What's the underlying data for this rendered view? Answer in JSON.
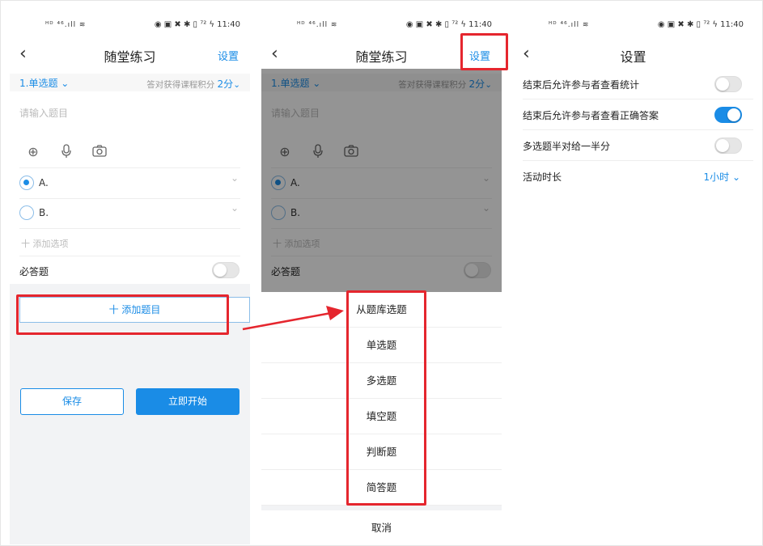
{
  "status": {
    "left": "ᴴᴰ ⁴⁶.ıll ≋",
    "right": "◉ ▣ ✖ ✱ ▯ ⁷² ϟ 11:40"
  },
  "editor": {
    "title": "随堂练习",
    "settings_label": "设置",
    "question_type": "1.单选题",
    "score_prefix": "答对获得课程积分",
    "score_value": "2分",
    "prompt_placeholder": "请输入题目",
    "options": [
      {
        "label": "A.",
        "selected": true
      },
      {
        "label": "B.",
        "selected": false
      }
    ],
    "add_option": "十 添加选项",
    "required_label": "必答题",
    "required_on": false,
    "add_question": "十 添加题目",
    "save_label": "保存",
    "start_label": "立即开始"
  },
  "action_sheet": {
    "items": [
      "从题库选题",
      "单选题",
      "多选题",
      "填空题",
      "判断题",
      "简答题"
    ],
    "cancel": "取消"
  },
  "settings": {
    "title": "设置",
    "rows": [
      {
        "label": "结束后允许参与者查看统计",
        "on": false
      },
      {
        "label": "结束后允许参与者查看正确答案",
        "on": true
      },
      {
        "label": "多选题半对给一半分",
        "on": false
      }
    ],
    "duration_label": "活动时长",
    "duration_value": "1小时"
  },
  "icons": {
    "back": "chevron-left-icon",
    "add": "plus-circle-icon",
    "mic": "microphone-icon",
    "camera": "camera-icon",
    "chevron": "chevron-down-icon"
  },
  "colors": {
    "accent": "#1a8ce6",
    "highlight": "#e5262e",
    "overlay": "rgba(0,0,0,0.42)"
  }
}
